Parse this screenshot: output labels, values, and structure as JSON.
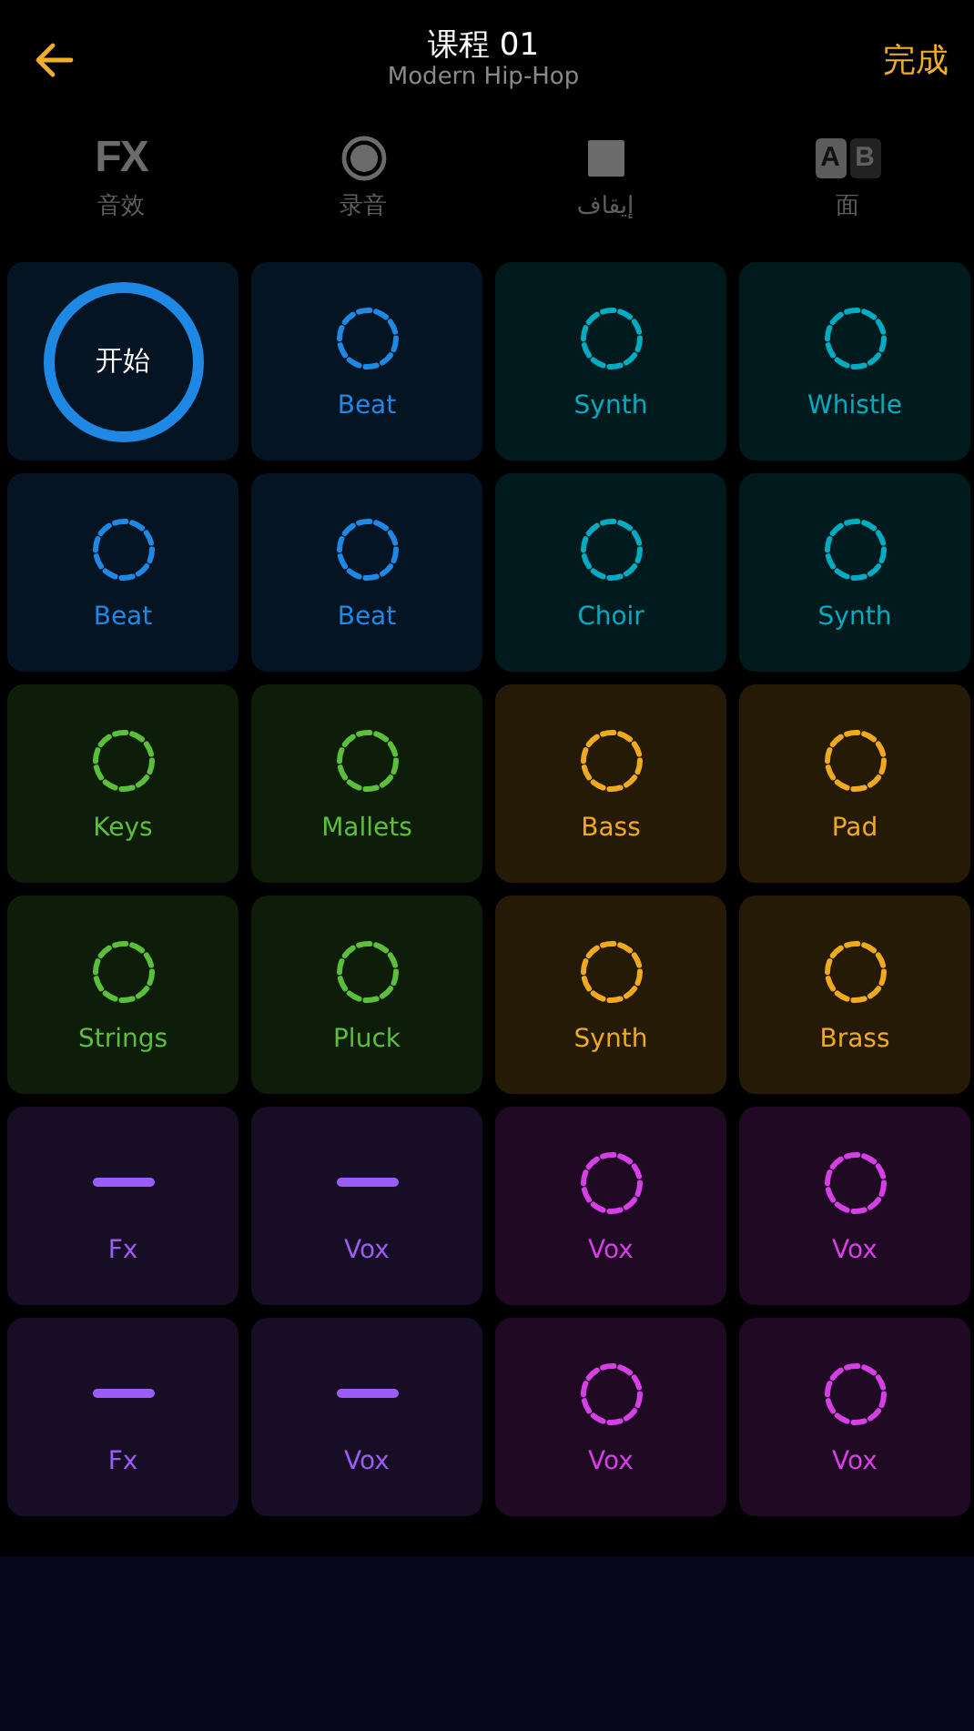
{
  "header": {
    "title": "课程 01",
    "subtitle": "Modern Hip-Hop",
    "done": "完成"
  },
  "toolbar": [
    {
      "kind": "fx",
      "glyph": "FX",
      "label": "音效"
    },
    {
      "kind": "record",
      "label": "录音"
    },
    {
      "kind": "stop",
      "label": "إيقاف"
    },
    {
      "kind": "ab",
      "glyph_a": "A",
      "glyph_b": "B",
      "label": "面"
    }
  ],
  "pads": [
    {
      "kind": "start",
      "label": "开始",
      "color": "#1e88e5"
    },
    {
      "kind": "loop",
      "label": "Beat",
      "color": "#1e88e5"
    },
    {
      "kind": "loop",
      "label": "Synth",
      "color": "#00acc1"
    },
    {
      "kind": "loop",
      "label": "Whistle",
      "color": "#00acc1"
    },
    {
      "kind": "loop",
      "label": "Beat",
      "color": "#1e88e5"
    },
    {
      "kind": "loop",
      "label": "Beat",
      "color": "#1e88e5"
    },
    {
      "kind": "loop",
      "label": "Choir",
      "color": "#00acc1"
    },
    {
      "kind": "loop",
      "label": "Synth",
      "color": "#00acc1"
    },
    {
      "kind": "loop",
      "label": "Keys",
      "color": "#5bbf3a"
    },
    {
      "kind": "loop",
      "label": "Mallets",
      "color": "#5bbf3a"
    },
    {
      "kind": "loop",
      "label": "Bass",
      "color": "#f0aa1e"
    },
    {
      "kind": "loop",
      "label": "Pad",
      "color": "#f0aa1e"
    },
    {
      "kind": "loop",
      "label": "Strings",
      "color": "#5bbf3a"
    },
    {
      "kind": "loop",
      "label": "Pluck",
      "color": "#5bbf3a"
    },
    {
      "kind": "loop",
      "label": "Synth",
      "color": "#f0aa1e"
    },
    {
      "kind": "loop",
      "label": "Brass",
      "color": "#f0aa1e"
    },
    {
      "kind": "oneshot",
      "label": "Fx",
      "color": "#9a5cf5"
    },
    {
      "kind": "oneshot",
      "label": "Vox",
      "color": "#9a5cf5"
    },
    {
      "kind": "loop",
      "label": "Vox",
      "color": "#d63ee6"
    },
    {
      "kind": "loop",
      "label": "Vox",
      "color": "#d63ee6"
    },
    {
      "kind": "oneshot",
      "label": "Fx",
      "color": "#9a5cf5"
    },
    {
      "kind": "oneshot",
      "label": "Vox",
      "color": "#9a5cf5"
    },
    {
      "kind": "loop",
      "label": "Vox",
      "color": "#d63ee6"
    },
    {
      "kind": "loop",
      "label": "Vox",
      "color": "#d63ee6"
    }
  ]
}
